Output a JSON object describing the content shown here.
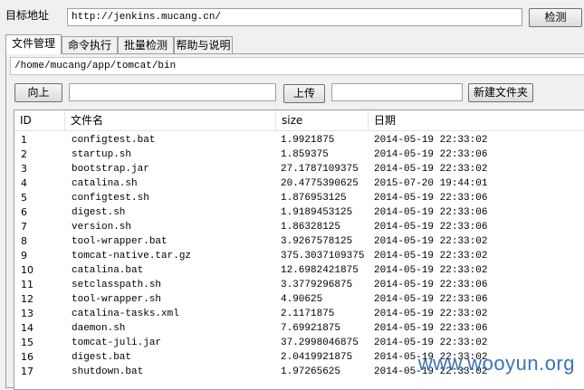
{
  "target": {
    "label": "目标地址",
    "url": "http://jenkins.mucang.cn/",
    "detect_button": "检测"
  },
  "tabs": [
    {
      "label": "文件管理",
      "active": true
    },
    {
      "label": "命令执行",
      "active": false
    },
    {
      "label": "批量检测",
      "active": false
    },
    {
      "label": "帮助与说明",
      "active": false
    }
  ],
  "file_manager": {
    "path": "/home/mucang/app/tomcat/bin",
    "up_button": "向上",
    "upload_button": "上传",
    "new_folder_button": "新建文件夹",
    "upload_input": "",
    "new_folder_input": ""
  },
  "table": {
    "columns": [
      "ID",
      "文件名",
      "size",
      "日期"
    ],
    "rows": [
      [
        "1",
        "configtest.bat",
        "1.9921875",
        "2014-05-19 22:33:02"
      ],
      [
        "2",
        "startup.sh",
        "1.859375",
        "2014-05-19 22:33:06"
      ],
      [
        "3",
        "bootstrap.jar",
        "27.1787109375",
        "2014-05-19 22:33:02"
      ],
      [
        "4",
        "catalina.sh",
        "20.4775390625",
        "2015-07-20 19:44:01"
      ],
      [
        "5",
        "configtest.sh",
        "1.876953125",
        "2014-05-19 22:33:06"
      ],
      [
        "6",
        "digest.sh",
        "1.9189453125",
        "2014-05-19 22:33:06"
      ],
      [
        "7",
        "version.sh",
        "1.86328125",
        "2014-05-19 22:33:06"
      ],
      [
        "8",
        "tool-wrapper.bat",
        "3.9267578125",
        "2014-05-19 22:33:02"
      ],
      [
        "9",
        "tomcat-native.tar.gz",
        "375.3037109375",
        "2014-05-19 22:33:02"
      ],
      [
        "10",
        "catalina.bat",
        "12.6982421875",
        "2014-05-19 22:33:02"
      ],
      [
        "11",
        "setclasspath.sh",
        "3.3779296875",
        "2014-05-19 22:33:06"
      ],
      [
        "12",
        "tool-wrapper.sh",
        "4.90625",
        "2014-05-19 22:33:06"
      ],
      [
        "13",
        "catalina-tasks.xml",
        "2.1171875",
        "2014-05-19 22:33:02"
      ],
      [
        "14",
        "daemon.sh",
        "7.69921875",
        "2014-05-19 22:33:06"
      ],
      [
        "15",
        "tomcat-juli.jar",
        "37.2998046875",
        "2014-05-19 22:33:02"
      ],
      [
        "16",
        "digest.bat",
        "2.0419921875",
        "2014-05-19 22:33:02"
      ],
      [
        "17",
        "shutdown.bat",
        "1.97265625",
        "2014-05-19 22:33:02"
      ]
    ]
  },
  "watermark": "www.wooyun.org"
}
